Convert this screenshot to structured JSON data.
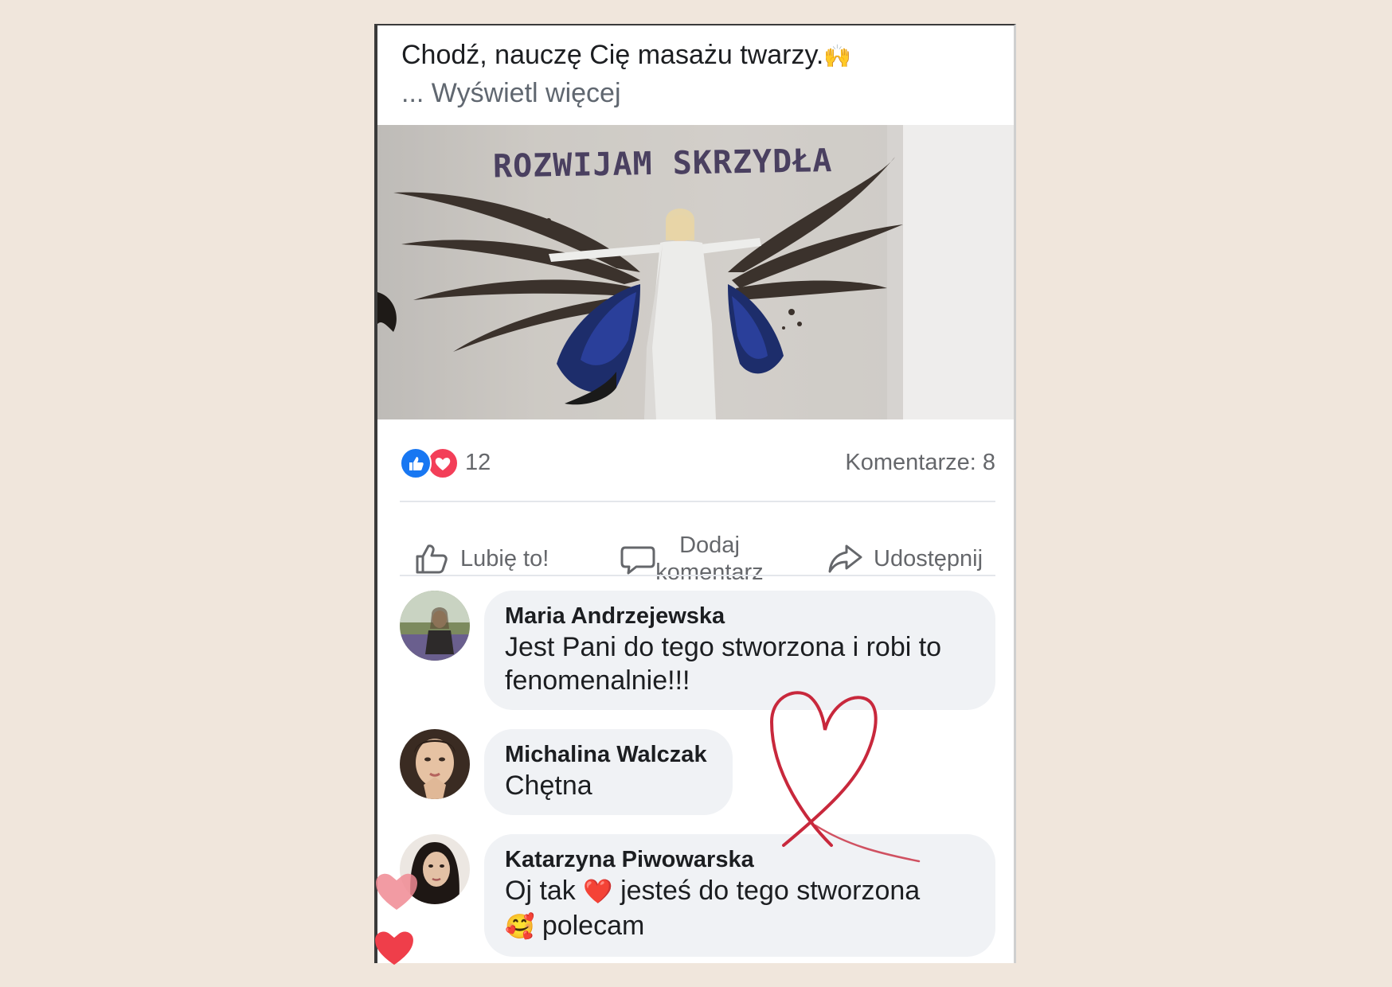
{
  "post": {
    "text": "Chodź, nauczę Cię masażu twarzy.",
    "text_emoji": "🙌",
    "see_more": "... Wyświetl więcej"
  },
  "photo": {
    "graffiti_text": "ROZWIJAM SKRZYDŁA"
  },
  "reactions": {
    "count": "12",
    "types": [
      "like-icon",
      "love-icon"
    ],
    "comments_label": "Komentarze: 8"
  },
  "actions": {
    "like_label": "Lubię to!",
    "comment_label_line1": "Dodaj",
    "comment_label_line2": "komentarz",
    "share_label": "Udostępnij"
  },
  "comments": [
    {
      "name": "Maria Andrzejewska",
      "text": "Jest Pani do tego stworzona i robi to fenomenalnie!!!"
    },
    {
      "name": "Michalina Walczak",
      "text": "Chętna"
    },
    {
      "name": "Katarzyna Piwowarska",
      "text_part1": "Oj tak",
      "emoji_heart": "❤️",
      "text_part2": "jesteś do tego stworzona",
      "emoji_smile": "🥰",
      "text_part3": "polecam"
    }
  ],
  "colors": {
    "background": "#f0e6dc",
    "like_blue": "#1877f2",
    "love_red": "#f33e58",
    "bubble": "#f0f2f5",
    "drawn_heart": "#c8283c"
  }
}
